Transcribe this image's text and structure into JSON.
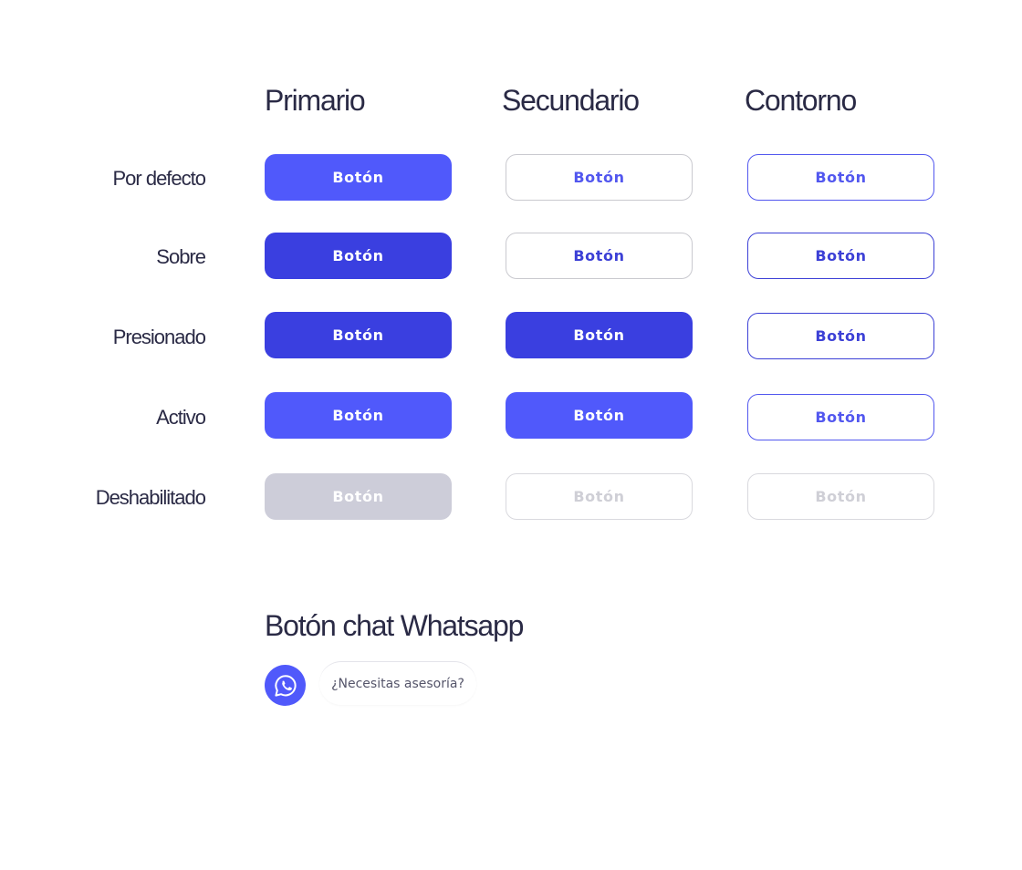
{
  "columns": {
    "primary": "Primario",
    "secondary": "Secundario",
    "outline": "Contorno"
  },
  "rows": {
    "default": "Por defecto",
    "hover": "Sobre",
    "pressed": "Presionado",
    "active": "Activo",
    "disabled": "Deshabilitado"
  },
  "button_label": "Botón",
  "whatsapp": {
    "title": "Botón chat Whatsapp",
    "bubble_text": "¿Necesitas asesoría?",
    "icon": "whatsapp-icon"
  },
  "colors": {
    "primary": "#5059fb",
    "primary_dark": "#3a3fe0",
    "disabled": "#cdcdd9",
    "text_dark": "#2a2a45"
  }
}
